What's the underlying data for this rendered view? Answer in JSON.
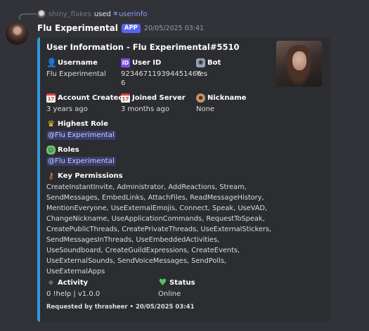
{
  "reply": {
    "username": "shiny_flakes",
    "used_text": "used",
    "command": "userinfo"
  },
  "message": {
    "author": "Flu Experimental",
    "tag": "APP",
    "timestamp": "20/05/2025 03:41"
  },
  "embed": {
    "accent_color": "#3498db",
    "title": "User Information - Flu Experimental#5510",
    "fields": {
      "username": {
        "icon": "bust-in-silhouette-icon",
        "name": "Username",
        "value": "Flu Experimental"
      },
      "user_id": {
        "icon": "id-icon",
        "name": "User ID",
        "value_line1": "923467119394451466",
        "value_line2": "6"
      },
      "bot": {
        "icon": "robot-icon",
        "name": "Bot",
        "value": "Yes"
      },
      "account_created": {
        "icon": "calendar-icon",
        "name": "Account Created",
        "value": "3 years ago"
      },
      "joined_server": {
        "icon": "calendar-icon",
        "name": "Joined Server",
        "value": "3 months ago"
      },
      "nickname": {
        "icon": "palette-icon",
        "name": "Nickname",
        "value": "None"
      },
      "highest_role": {
        "icon": "crown-icon",
        "name": "Highest Role",
        "value": "@Flu Experimental"
      },
      "roles": {
        "icon": "performing-arts-icon",
        "name": "Roles",
        "value": "@Flu Experimental"
      },
      "key_permissions": {
        "icon": "key-icon",
        "name": "Key Permissions",
        "lines": [
          "CreateInstantInvite, Administrator, AddReactions, Stream,",
          "SendMessages, EmbedLinks, AttachFiles, ReadMessageHistory,",
          "MentionEveryone, UseExternalEmojis, Connect, Speak, UseVAD,",
          "ChangeNickname, UseApplicationCommands, RequestToSpeak,",
          "CreatePublicThreads, CreatePrivateThreads, UseExternalStickers,",
          "SendMessagesInThreads, UseEmbeddedActivities,",
          "UseSoundboard, CreateGuildExpressions, CreateEvents,",
          "UseExternalSounds, SendVoiceMessages, SendPolls,",
          "UseExternalApps"
        ]
      },
      "activity": {
        "icon": "sparkles-icon",
        "name": "Activity",
        "value": "0 !help | v1.0.0"
      },
      "status": {
        "icon": "green-heart-icon",
        "name": "Status",
        "value": "Online"
      }
    },
    "footer": "Requested by thrasheer • 20/05/2025 03:41"
  }
}
